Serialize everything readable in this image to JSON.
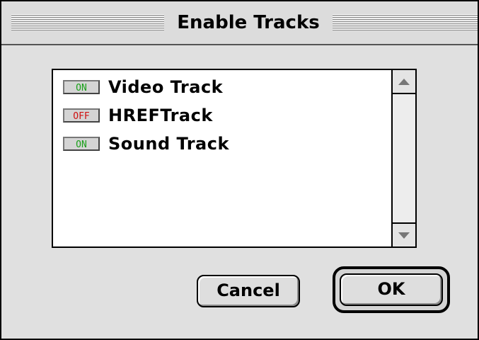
{
  "window": {
    "title": "Enable Tracks"
  },
  "tracks": [
    {
      "state": "ON",
      "label": "Video Track"
    },
    {
      "state": "OFF",
      "label": "HREFTrack"
    },
    {
      "state": "ON",
      "label": "Sound Track"
    }
  ],
  "buttons": {
    "cancel_label": "Cancel",
    "ok_label": "OK"
  },
  "colors": {
    "on": "#19a019",
    "off": "#d01010"
  }
}
